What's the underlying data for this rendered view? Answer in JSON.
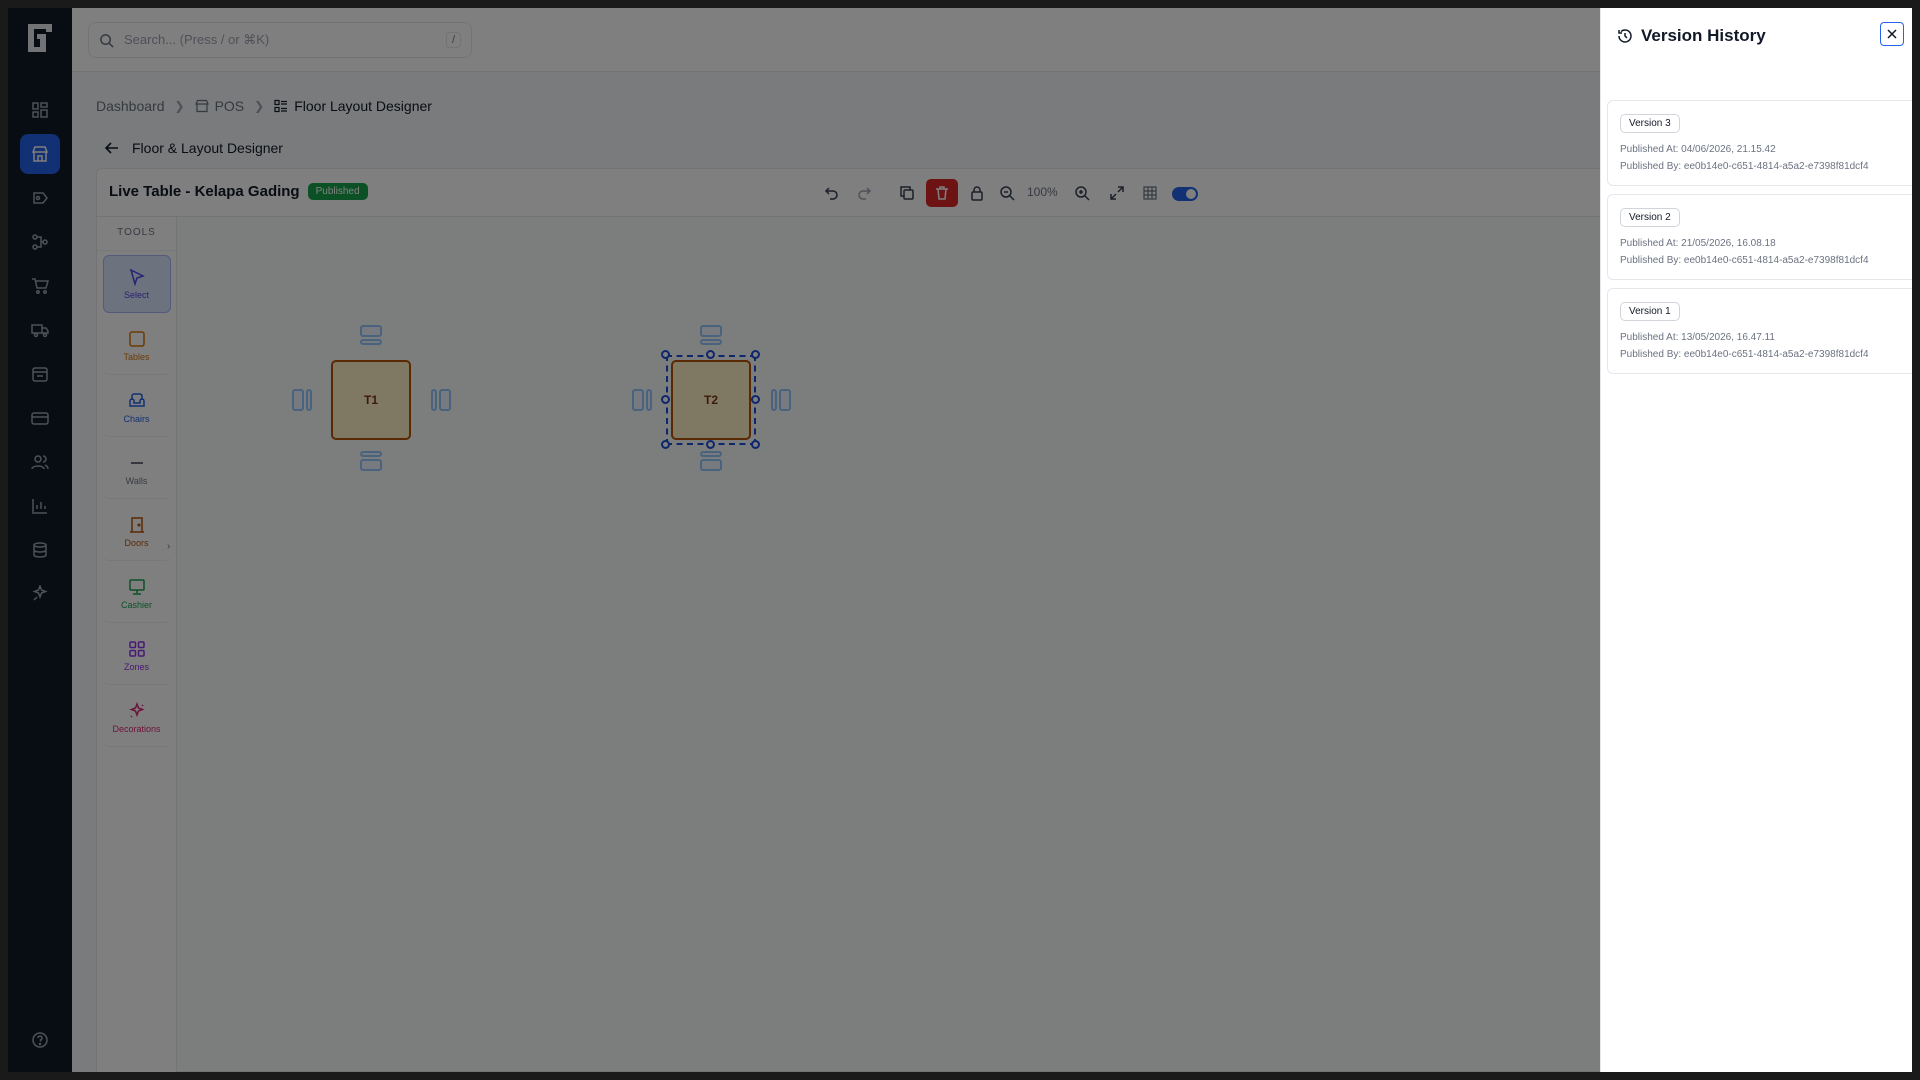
{
  "search": {
    "placeholder": "Search... (Press / or ⌘K)",
    "shortcut": "/"
  },
  "breadcrumb": [
    {
      "label": "Dashboard"
    },
    {
      "label": "POS"
    },
    {
      "label": "Floor Layout Designer"
    }
  ],
  "page": {
    "back_title": "Floor & Layout Designer"
  },
  "designer": {
    "title": "Live Table - Kelapa Gading",
    "status": "Published",
    "zoom": "100%",
    "grid_snap_enabled": true
  },
  "tools": {
    "header": "TOOLS",
    "items": [
      {
        "label": "Select",
        "color": "#4f46e5"
      },
      {
        "label": "Tables",
        "color": "#d97706"
      },
      {
        "label": "Chairs",
        "color": "#2563eb"
      },
      {
        "label": "Walls",
        "color": "#6b7280"
      },
      {
        "label": "Doors",
        "color": "#b45309"
      },
      {
        "label": "Cashier",
        "color": "#16a34a"
      },
      {
        "label": "Zones",
        "color": "#9333ea"
      },
      {
        "label": "Decorations",
        "color": "#db2777"
      }
    ]
  },
  "canvas": {
    "tables": [
      {
        "label": "T1"
      },
      {
        "label": "T2"
      }
    ]
  },
  "version_history": {
    "title": "Version History",
    "versions": [
      {
        "tag": "Version 3",
        "published_at": "Published At: 04/06/2026, 21.15.42",
        "published_by": "Published By: ee0b14e0-c651-4814-a5a2-e7398f81dcf4"
      },
      {
        "tag": "Version 2",
        "published_at": "Published At: 21/05/2026, 16.08.18",
        "published_by": "Published By: ee0b14e0-c651-4814-a5a2-e7398f81dcf4"
      },
      {
        "tag": "Version 1",
        "published_at": "Published At: 13/05/2026, 16.47.11",
        "published_by": "Published By: ee0b14e0-c651-4814-a5a2-e7398f81dcf4"
      }
    ]
  },
  "sidebar": {
    "icons": [
      "dashboard-icon",
      "pos-icon",
      "promotions-icon",
      "workflow-icon",
      "cart-icon",
      "delivery-icon",
      "inventory-icon",
      "payments-icon",
      "users-icon",
      "reports-icon",
      "database-icon",
      "integrations-icon",
      "help-icon"
    ]
  }
}
